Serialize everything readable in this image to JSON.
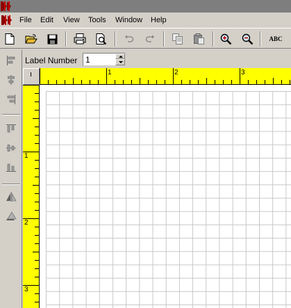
{
  "menu": {
    "items": [
      {
        "label": "File"
      },
      {
        "label": "Edit"
      },
      {
        "label": "View"
      },
      {
        "label": "Tools"
      },
      {
        "label": "Window"
      },
      {
        "label": "Help"
      }
    ]
  },
  "toolbar": {
    "buttons": [
      {
        "icon": "new-document-icon"
      },
      {
        "icon": "open-folder-icon"
      },
      {
        "icon": "save-icon"
      },
      {
        "icon": "print-icon"
      },
      {
        "icon": "print-preview-icon"
      },
      {
        "icon": "undo-icon"
      },
      {
        "icon": "redo-icon"
      },
      {
        "icon": "copy-icon"
      },
      {
        "icon": "paste-icon"
      },
      {
        "icon": "zoom-in-icon"
      },
      {
        "icon": "zoom-out-icon"
      },
      {
        "icon": "spell-check-icon"
      }
    ],
    "spell_label": "ABC"
  },
  "sidebar": {
    "tools": [
      {
        "icon": "align-left-icon"
      },
      {
        "icon": "align-center-horizontal-icon"
      },
      {
        "icon": "align-right-icon"
      },
      {
        "icon": "align-top-icon"
      },
      {
        "icon": "align-center-vertical-icon"
      },
      {
        "icon": "align-bottom-icon"
      },
      {
        "icon": "flip-horizontal-icon"
      },
      {
        "icon": "flip-vertical-icon"
      }
    ]
  },
  "label_row": {
    "label": "Label Number",
    "value": "1"
  },
  "ruler": {
    "horizontal_labels": [
      "1",
      "2",
      "3"
    ],
    "vertical_labels": [
      "1",
      "2",
      "3"
    ]
  },
  "colors": {
    "ruler": "#ffff00",
    "chrome": "#d4d0c8",
    "title": "#7e7e7e",
    "logo": "#8b0000"
  }
}
